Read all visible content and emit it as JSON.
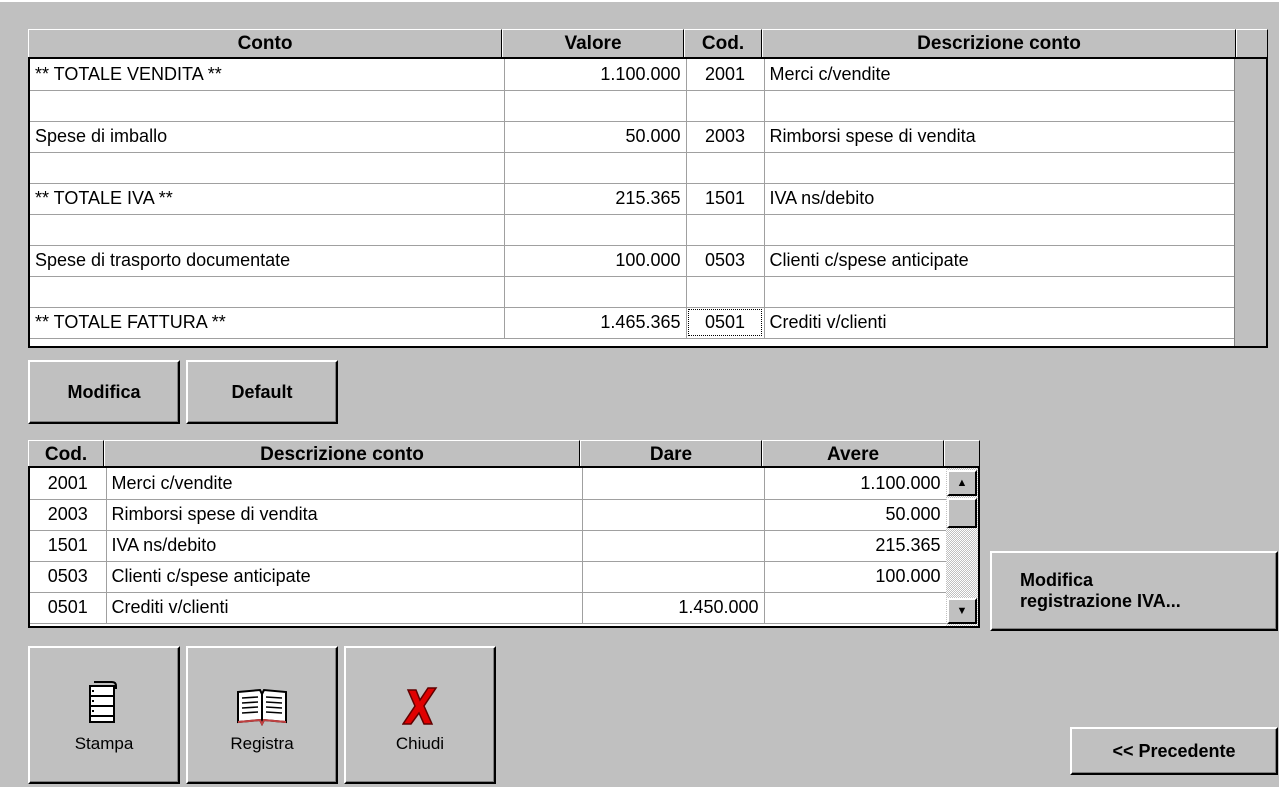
{
  "top_grid": {
    "headers": [
      "Conto",
      "Valore",
      "Cod.",
      "Descrizione conto"
    ],
    "rows": [
      {
        "conto": "** TOTALE VENDITA **",
        "valore": "1.100.000",
        "cod": "2001",
        "descrizione": "Merci c/vendite"
      },
      {
        "conto": "",
        "valore": "",
        "cod": "",
        "descrizione": ""
      },
      {
        "conto": "Spese di imballo",
        "valore": "50.000",
        "cod": "2003",
        "descrizione": "Rimborsi spese di vendita"
      },
      {
        "conto": "",
        "valore": "",
        "cod": "",
        "descrizione": ""
      },
      {
        "conto": "** TOTALE IVA **",
        "valore": "215.365",
        "cod": "1501",
        "descrizione": "IVA ns/debito"
      },
      {
        "conto": "",
        "valore": "",
        "cod": "",
        "descrizione": ""
      },
      {
        "conto": "Spese di trasporto documentate",
        "valore": "100.000",
        "cod": "0503",
        "descrizione": "Clienti c/spese anticipate"
      },
      {
        "conto": "",
        "valore": "",
        "cod": "",
        "descrizione": ""
      },
      {
        "conto": "** TOTALE FATTURA **",
        "valore": "1.465.365",
        "cod": "0501",
        "descrizione": "Crediti v/clienti"
      }
    ]
  },
  "buttons": {
    "modifica": "Modifica",
    "default": "Default",
    "modifica_iva_line1": "Modifica",
    "modifica_iva_line2": "registrazione IVA...",
    "stampa": "Stampa",
    "registra": "Registra",
    "chiudi": "Chiudi",
    "precedente": "<< Precedente"
  },
  "bottom_grid": {
    "headers": [
      "Cod.",
      "Descrizione conto",
      "Dare",
      "Avere"
    ],
    "rows": [
      {
        "cod": "2001",
        "descrizione": "Merci c/vendite",
        "dare": "",
        "avere": "1.100.000"
      },
      {
        "cod": "2003",
        "descrizione": "Rimborsi spese di vendita",
        "dare": "",
        "avere": "50.000"
      },
      {
        "cod": "1501",
        "descrizione": "IVA ns/debito",
        "dare": "",
        "avere": "215.365"
      },
      {
        "cod": "0503",
        "descrizione": "Clienti c/spese anticipate",
        "dare": "",
        "avere": "100.000"
      },
      {
        "cod": "0501",
        "descrizione": "Crediti v/clienti",
        "dare": "1.450.000",
        "avere": ""
      }
    ]
  },
  "icons": {
    "stampa": "printer-icon",
    "registra": "book-icon",
    "chiudi": "red-x-icon",
    "scroll_up": "up-arrow-icon",
    "scroll_down": "down-arrow-icon"
  },
  "colors": {
    "background": "#c0c0c0",
    "grid_bg": "#ffffff",
    "close_x": "#e00000"
  }
}
